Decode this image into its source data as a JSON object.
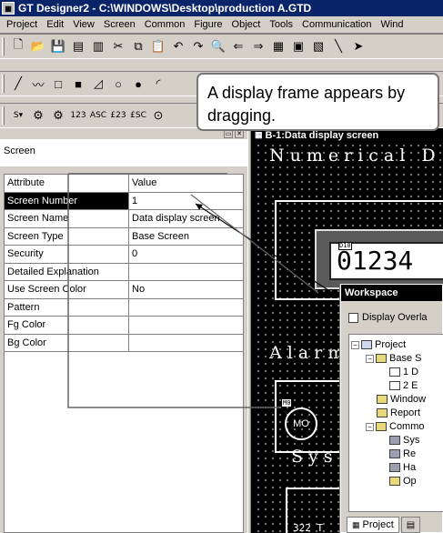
{
  "window": {
    "title": "GT Designer2 - C:\\WINDOWS\\Desktop\\production A.GTD",
    "app_icon": "gt-designer-icon"
  },
  "menu": [
    "Project",
    "Edit",
    "View",
    "Screen",
    "Common",
    "Figure",
    "Object",
    "Tools",
    "Communication",
    "Wind"
  ],
  "toolbar1": [
    "new-icon",
    "open-icon",
    "save-icon",
    "save-all-icon",
    "print-icon",
    "cut-icon",
    "copy-icon",
    "paste-icon",
    "undo-icon",
    "redo-icon",
    "zoom-icon",
    "back-icon",
    "forward-icon",
    "screen-list-icon",
    "grid-icon",
    "layer-icon",
    "line-tool-icon",
    "pointer-icon"
  ],
  "toolbar2": [
    "line-icon",
    "polyline-icon",
    "rectangle-icon",
    "filled-rectangle-icon",
    "polygon-icon",
    "circle-icon",
    "filled-circle-icon",
    "arc-icon"
  ],
  "toolbar3": {
    "labels": [
      "S▾",
      "",
      "",
      "123",
      "ASC",
      "£23",
      "£SC",
      ""
    ]
  },
  "callout": "A display frame appears by dragging.",
  "property_panel": {
    "screen_label": "Screen",
    "header": {
      "attribute": "Attribute",
      "value": "Value"
    },
    "rows": [
      {
        "attribute": "Screen Number",
        "value": "1"
      },
      {
        "attribute": "Screen Name",
        "value": "Data display screen"
      },
      {
        "attribute": "Screen Type",
        "value": "Base Screen"
      },
      {
        "attribute": "Security",
        "value": "0"
      },
      {
        "attribute": "Detailed Explanation",
        "value": ""
      },
      {
        "attribute": "Use Screen Color",
        "value": "No"
      },
      {
        "attribute": "Pattern",
        "value": ""
      },
      {
        "attribute": "Fg Color",
        "value": ""
      },
      {
        "attribute": "Bg Color",
        "value": ""
      }
    ],
    "selected_row": 0
  },
  "editor": {
    "screen_title": "B-1:Data display screen",
    "heading1": "Numerical D",
    "numeric_tag": "D10",
    "numeric_value": "01234",
    "heading2": "Alarm",
    "lamp_tag": "M0",
    "lamp_label": "MO",
    "heading3": "Sys",
    "bottom_text": "322 T"
  },
  "workspace": {
    "title": "Workspace",
    "checkbox_label": "Display Overla",
    "tree": [
      {
        "label": "Project",
        "level": 0,
        "toggle": "−",
        "icon": "project"
      },
      {
        "label": "Base S",
        "level": 1,
        "toggle": "−",
        "icon": "folder"
      },
      {
        "label": "1 D",
        "level": 2,
        "toggle": "",
        "icon": "screen"
      },
      {
        "label": "2 E",
        "level": 2,
        "toggle": "",
        "icon": "screen"
      },
      {
        "label": "Window",
        "level": 1,
        "toggle": "",
        "icon": "folder"
      },
      {
        "label": "Report",
        "level": 1,
        "toggle": "",
        "icon": "folder"
      },
      {
        "label": "Commo",
        "level": 1,
        "toggle": "−",
        "icon": "folder"
      },
      {
        "label": "Sys",
        "level": 2,
        "toggle": "",
        "icon": "misc"
      },
      {
        "label": "Re",
        "level": 2,
        "toggle": "",
        "icon": "misc"
      },
      {
        "label": "Ha",
        "level": 2,
        "toggle": "",
        "icon": "misc"
      },
      {
        "label": "Op",
        "level": 2,
        "toggle": "",
        "icon": "folder"
      }
    ],
    "tabs": [
      "Project",
      ""
    ]
  }
}
